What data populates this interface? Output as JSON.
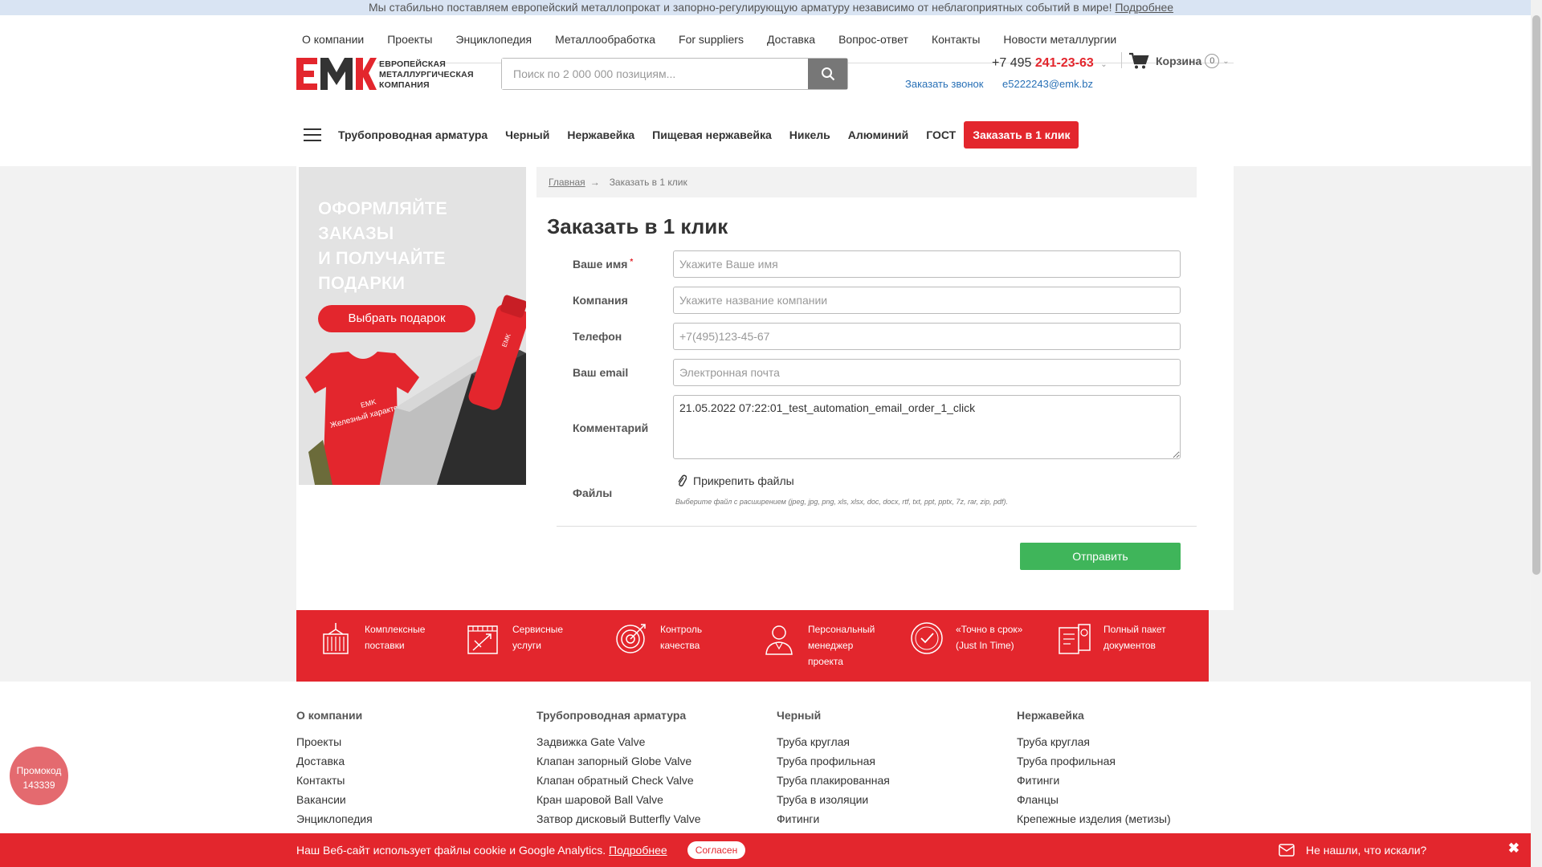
{
  "announcement": {
    "text": "Мы стабильно поставляем европейский металлопрокат и запорно-регулирующую арматуру независимо от неблагоприятных событий в мире!",
    "link": "Подробнее"
  },
  "top_nav": [
    "О компании",
    "Проекты",
    "Энциклопедия",
    "Металлообработка",
    "For suppliers",
    "Доставка",
    "Вопрос-ответ",
    "Контакты",
    "Новости металлургии"
  ],
  "logo": {
    "mark": "EMK",
    "line1": "ЕВРОПЕЙСКАЯ",
    "line2": "МЕТАЛЛУРГИЧЕСКАЯ",
    "line3": "КОМПАНИЯ"
  },
  "search": {
    "placeholder": "Поиск по 2 000 000 позициям...",
    "icon": "search-icon"
  },
  "contacts": {
    "phone_prefix": "+7 495",
    "phone_number": "241-23-63",
    "callback": "Заказать звонок",
    "email": "e5222243@emk.bz"
  },
  "cart": {
    "label": "Корзина",
    "count": "0",
    "icon": "cart-icon"
  },
  "main_nav": {
    "items": [
      "Трубопроводная арматура",
      "Черный",
      "Нержавейка",
      "Пищевая нержавейка",
      "Никель",
      "Алюминий",
      "ГОСТ"
    ],
    "order_button": "Заказать в 1 клик"
  },
  "promo": {
    "headline": [
      "ОФОРМЛЯЙТЕ",
      "ЗАКАЗЫ",
      "И ПОЛУЧАЙТЕ",
      "ПОДАРКИ"
    ],
    "button": "Выбрать подарок",
    "tshirt_text": "Железный характер",
    "tshirt_brand": "EMK",
    "bottle_brand": "EMK"
  },
  "breadcrumb": {
    "home": "Главная",
    "separator": "→",
    "current": "Заказать в 1 клик"
  },
  "page_title": "Заказать в 1 клик",
  "form": {
    "name_label": "Ваше имя",
    "name_required": "*",
    "name_placeholder": "Укажите Ваше имя",
    "company_label": "Компания",
    "company_placeholder": "Укажите название компании",
    "phone_label": "Телефон",
    "phone_placeholder": "+7(495)123-45-67",
    "email_label": "Ваш email",
    "email_placeholder": "Электронная почта",
    "comment_label": "Комментарий",
    "comment_value": "21.05.2022 07:22:01_test_automation_email_order_1_click",
    "files_label": "Файлы",
    "attach_label": "Прикрепить файлы",
    "attach_hint": "Выберите файл с расширением (jpeg, jpg, png, xls, xlsx, doc, docx, rtf, txt, ppt, pptx, 7z, rar, zip, pdf).",
    "submit": "Отправить"
  },
  "features": [
    {
      "icon": "container-icon",
      "line1": "Комплексные",
      "line2": "поставки"
    },
    {
      "icon": "blueprint-icon",
      "line1": "Сервисные",
      "line2": "услуги"
    },
    {
      "icon": "target-icon",
      "line1": "Контроль",
      "line2": "качества"
    },
    {
      "icon": "manager-icon",
      "line1": "Персональный",
      "line2": "менеджер",
      "line3": "проекта"
    },
    {
      "icon": "clock-icon",
      "line1": "«Точно в срок»",
      "line2": "(Just In Time)"
    },
    {
      "icon": "documents-icon",
      "line1": "Полный пакет",
      "line2": "документов"
    }
  ],
  "footer": {
    "col1": {
      "heading": "О компании",
      "links": [
        "Проекты",
        "Доставка",
        "Контакты",
        "Вакансии",
        "Энциклопедия"
      ]
    },
    "col2": {
      "heading": "Трубопроводная арматура",
      "links": [
        "Задвижка Gate Valve",
        "Клапан запорный Globe Valve",
        "Клапан обратный Check Valve",
        "Кран шаровой Ball Valve",
        "Затвор дисковый Butterfly Valve"
      ]
    },
    "col3": {
      "heading": "Черный",
      "links": [
        "Труба круглая",
        "Труба профильная",
        "Труба плакированная",
        "Труба в изоляции",
        "Фитинги"
      ]
    },
    "col4": {
      "heading": "Нержавейка",
      "links": [
        "Труба круглая",
        "Труба профильная",
        "Фитинги",
        "Фланцы",
        "Крепежные изделия (метизы)"
      ]
    }
  },
  "promocode": {
    "line1": "Промокод",
    "line2": "143339"
  },
  "cookie": {
    "text": "Наш Веб-сайт использует файлы cookie и Google Analytics.",
    "link": "Подробнее",
    "button": "Согласен"
  },
  "not_found": {
    "text": "Не нашли, что искали?",
    "close": "✖"
  },
  "colors": {
    "brand_red": "#e3262d",
    "submit_green": "#3fb55a",
    "link_blue": "#2870b6"
  }
}
